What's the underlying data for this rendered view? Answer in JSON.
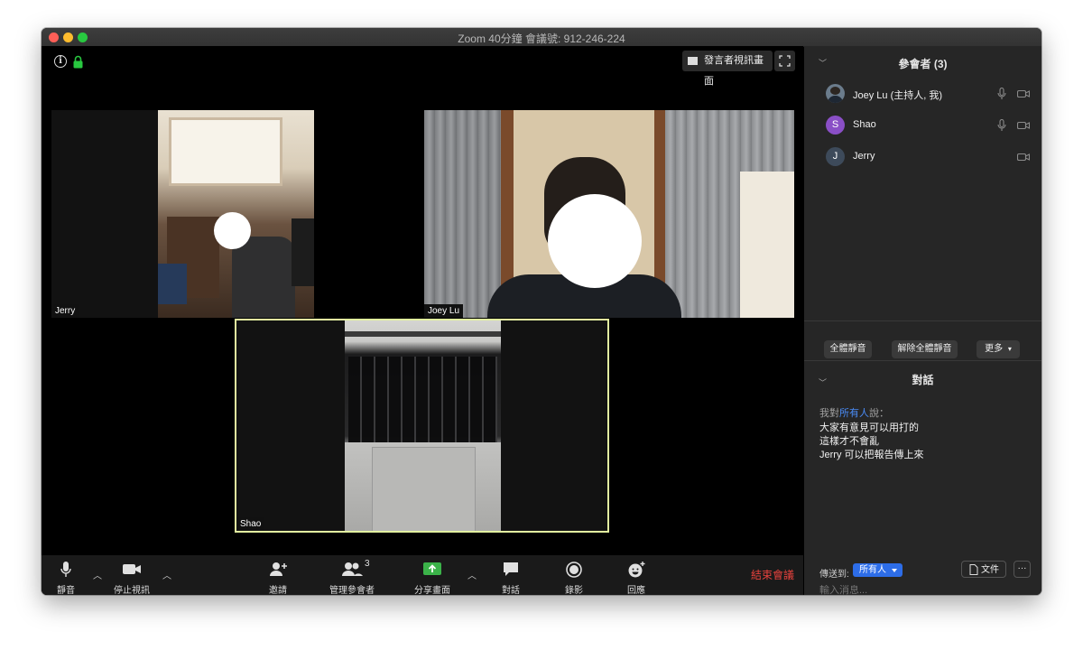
{
  "window": {
    "title": "Zoom   40分鐘  會議號: 912-246-224"
  },
  "top_controls": {
    "speaker_view_label": "發言者視訊畫面"
  },
  "videos": [
    {
      "name": "Jerry"
    },
    {
      "name": "Joey Lu"
    },
    {
      "name": "Shao"
    }
  ],
  "toolbar": {
    "mute_label": "靜音",
    "stop_video_label": "停止視訊",
    "invite_label": "邀請",
    "manage_participants_label": "管理參會者",
    "participant_count": "3",
    "share_screen_label": "分享畫面",
    "chat_label": "對話",
    "record_label": "錄影",
    "reactions_label": "回應",
    "end_meeting_label": "結束會議"
  },
  "participants_panel": {
    "title": "參會者 (3)",
    "participants": [
      {
        "name": "Joey Lu (主持人, 我)",
        "initial": "",
        "avatar_color": "#6b7c8c",
        "mic": true,
        "camera": true
      },
      {
        "name": "Shao",
        "initial": "S",
        "avatar_color": "#8a4fc6",
        "mic": true,
        "camera": true
      },
      {
        "name": "Jerry",
        "initial": "J",
        "avatar_color": "#3d4a5a",
        "mic": false,
        "camera": true
      }
    ],
    "mute_all_label": "全體靜音",
    "unmute_all_label": "解除全體靜音",
    "more_label": "更多"
  },
  "chat_panel": {
    "title": "對話",
    "sender_prefix": "我對",
    "sender_target": "所有人",
    "sender_suffix": "說：",
    "messages": [
      "大家有意見可以用打的",
      "這樣才不會亂",
      "Jerry 可以把報告傳上來"
    ],
    "send_to_label": "傳送到:",
    "send_to_value": "所有人",
    "file_label": "文件",
    "more_label": "···",
    "input_placeholder": "輸入消息..."
  },
  "colors": {
    "accent": "#2d6de8",
    "end_meeting": "#e8423d",
    "active_speaker_border": "#e2f0a0",
    "share_green": "#3bb249"
  }
}
